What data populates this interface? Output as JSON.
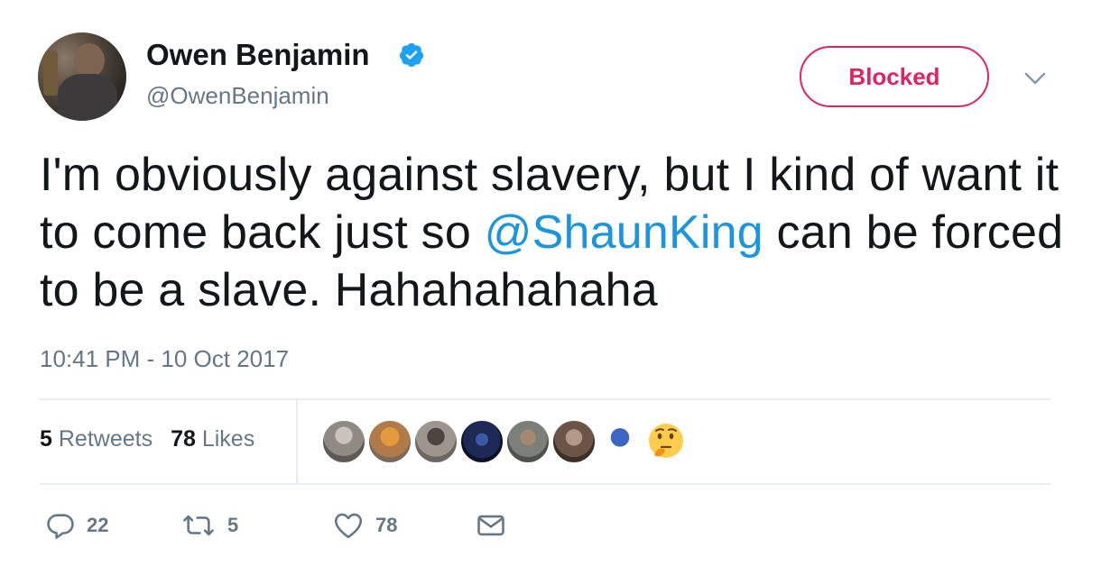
{
  "user": {
    "display_name": "Owen Benjamin",
    "handle": "@OwenBenjamin",
    "verified_icon": "verified-badge-icon",
    "verified_color": "#1da1f2"
  },
  "follow_button": {
    "label": "Blocked",
    "color": "#e0245e"
  },
  "tweet": {
    "text_before": "I'm obviously against slavery, but I kind of want it to come back just so ",
    "mention": "@ShaunKing",
    "text_after": " can be forced to be a slave. Hahahahahaha",
    "timestamp": "10:41 PM - 10 Oct 2017",
    "mention_color": "#1b95e0"
  },
  "stats": {
    "retweets_count": "5",
    "retweets_label": "Retweets",
    "likes_count": "78",
    "likes_label": "Likes"
  },
  "likers": [
    {
      "name": "liker-avatar-1",
      "color": "#8f8a84"
    },
    {
      "name": "liker-avatar-2",
      "color": "#b07a4a"
    },
    {
      "name": "liker-avatar-3",
      "color": "#6b6661"
    },
    {
      "name": "liker-avatar-4",
      "color": "#1e2a55"
    },
    {
      "name": "liker-avatar-5",
      "color": "#7a8079"
    },
    {
      "name": "liker-avatar-6",
      "color": "#6b5547"
    },
    {
      "name": "liker-avatar-7",
      "color": "#2e4a8a"
    },
    {
      "name": "liker-avatar-8-thinking-emoji",
      "color": "#ffcc4d"
    }
  ],
  "actions": {
    "reply_count": "22",
    "retweet_count": "5",
    "like_count": "78",
    "reply_icon": "reply-icon",
    "retweet_icon": "retweet-icon",
    "like_icon": "heart-icon",
    "dm_icon": "envelope-icon"
  }
}
